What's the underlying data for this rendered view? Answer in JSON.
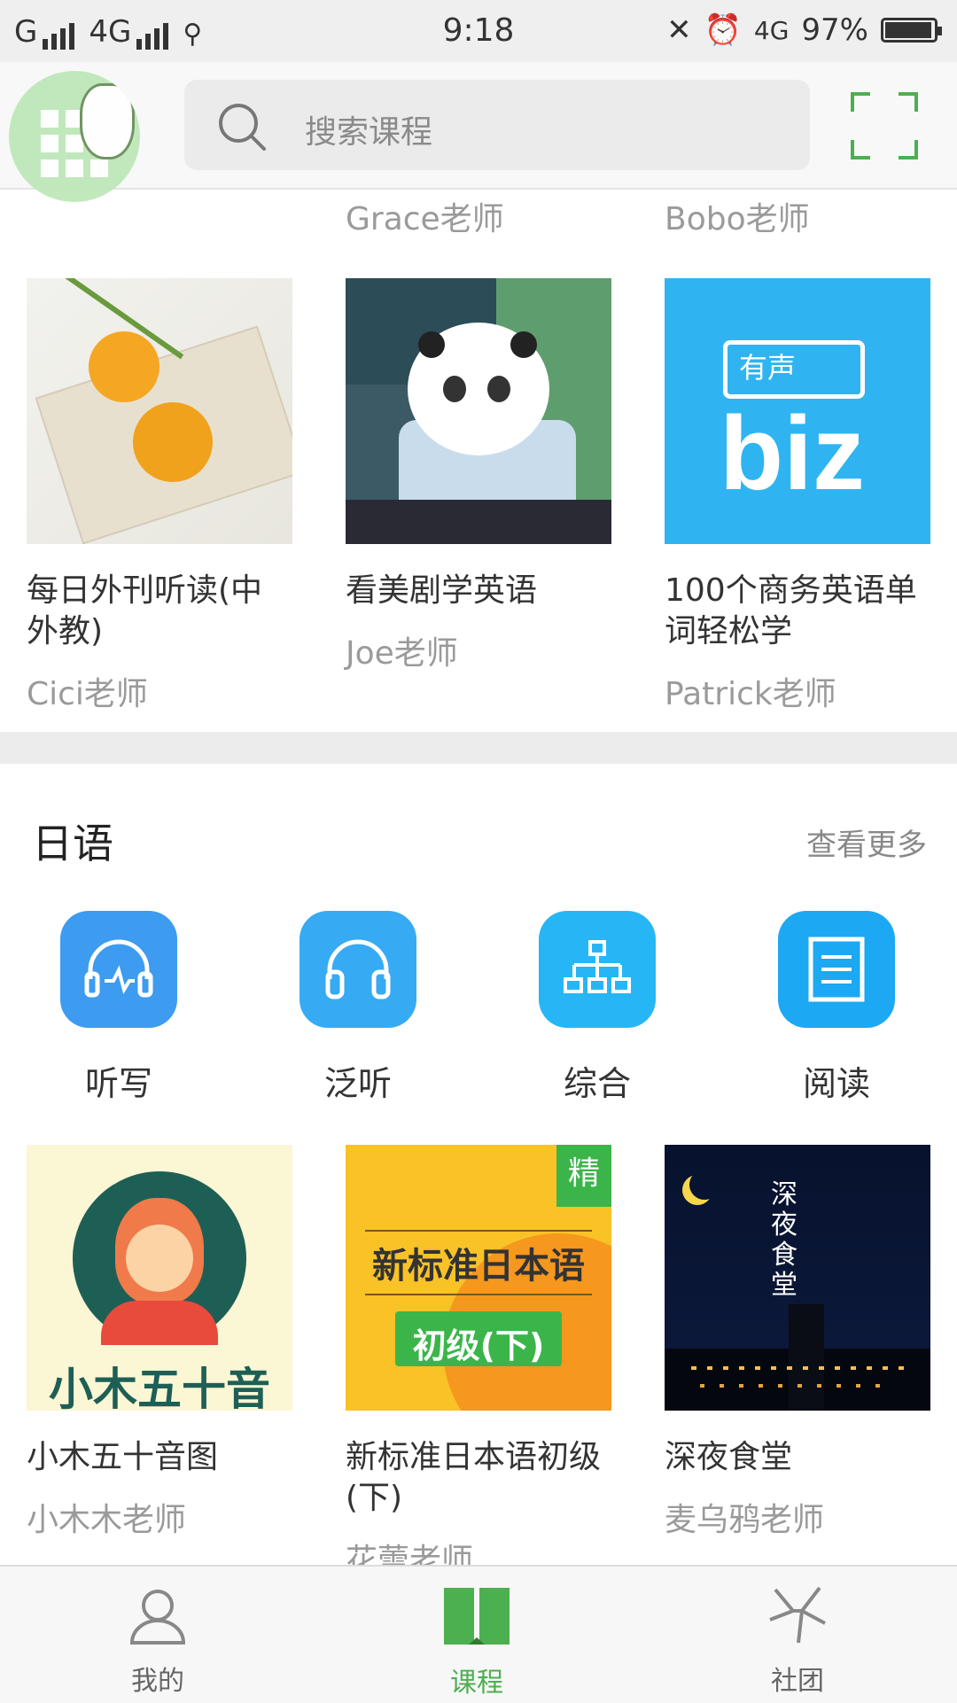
{
  "status_bar": {
    "carrier_left": "G",
    "network": "4G",
    "time": "9:18",
    "network_right": "4G",
    "battery_text": "97%",
    "battery_level": 0.97
  },
  "header": {
    "search_placeholder": "搜索课程"
  },
  "top_row_teachers": [
    "Grace老师",
    "Bobo老师"
  ],
  "row1": [
    {
      "title": "每日外刊听读(中外教)",
      "teacher": "Cici老师"
    },
    {
      "title": "看美剧学英语",
      "teacher": "Joe老师"
    },
    {
      "title": "100个商务英语单词轻松学",
      "teacher": "Patrick老师",
      "image_text": [
        "有声",
        "biz"
      ]
    }
  ],
  "japanese_section": {
    "title": "日语",
    "more_label": "查看更多",
    "categories": [
      {
        "label": "听写",
        "icon": "headphones-wave-icon"
      },
      {
        "label": "泛听",
        "icon": "headphones-icon"
      },
      {
        "label": "综合",
        "icon": "hierarchy-icon"
      },
      {
        "label": "阅读",
        "icon": "document-icon"
      }
    ],
    "courses": [
      {
        "title": "小木五十音图",
        "teacher": "小木木老师",
        "image_text": "小木五十音图"
      },
      {
        "title": "新标准日本语初级(下)",
        "teacher": "花蕾老师",
        "image_text": [
          "新标准日本语",
          "初级(下)"
        ],
        "badge": "精"
      },
      {
        "title": "深夜食堂",
        "teacher": "麦乌鸦老师",
        "image_text": "深夜食堂"
      }
    ]
  },
  "bottom_nav": {
    "items": [
      {
        "label": "我的",
        "icon": "user-icon"
      },
      {
        "label": "课程",
        "icon": "book-icon"
      },
      {
        "label": "社团",
        "icon": "community-icon"
      }
    ],
    "active": "课程"
  },
  "colors": {
    "accent_green": "#4caf50",
    "category_blue": "#2aa7f5",
    "separator": "#ececec"
  }
}
